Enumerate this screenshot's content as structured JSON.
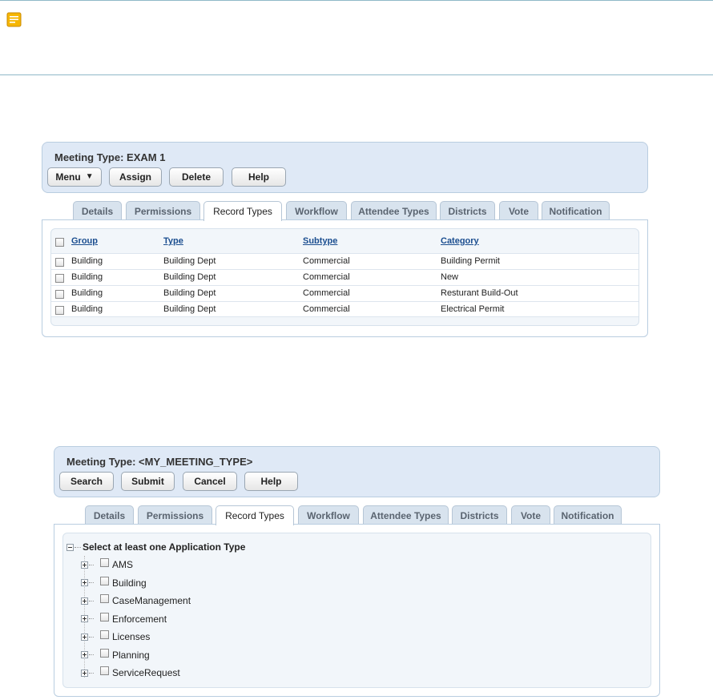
{
  "panel1": {
    "title": "Meeting Type: EXAM 1",
    "buttons": {
      "menu": "Menu",
      "assign": "Assign",
      "delete": "Delete",
      "help": "Help"
    },
    "tabs": [
      "Details",
      "Permissions",
      "Record Types",
      "Workflow",
      "Attendee Types",
      "Districts",
      "Vote",
      "Notification"
    ],
    "active_tab": "Record Types",
    "table": {
      "headers": {
        "group": "Group",
        "type": "Type",
        "subtype": "Subtype",
        "category": "Category"
      },
      "rows": [
        {
          "group": "Building",
          "type": "Building Dept",
          "subtype": "Commercial",
          "category": "Building Permit"
        },
        {
          "group": "Building",
          "type": "Building Dept",
          "subtype": "Commercial",
          "category": "New"
        },
        {
          "group": "Building",
          "type": "Building Dept",
          "subtype": "Commercial",
          "category": "Resturant Build-Out"
        },
        {
          "group": "Building",
          "type": "Building Dept",
          "subtype": "Commercial",
          "category": "Electrical Permit"
        }
      ]
    }
  },
  "panel2": {
    "title": "Meeting Type: <MY_MEETING_TYPE>",
    "buttons": {
      "search": "Search",
      "submit": "Submit",
      "cancel": "Cancel",
      "help": "Help"
    },
    "tabs": [
      "Details",
      "Permissions",
      "Record Types",
      "Workflow",
      "Attendee Types",
      "Districts",
      "Vote",
      "Notification"
    ],
    "active_tab": "Record Types",
    "tree": {
      "root_label": "Select at least one Application Type",
      "items": [
        "AMS",
        "Building",
        "CaseManagement",
        "Enforcement",
        "Licenses",
        "Planning",
        "ServiceRequest"
      ]
    }
  },
  "colors": {
    "accent": "#1a4d8f",
    "panel_bg": "#dfe9f6",
    "note_icon": "#f0a500"
  },
  "icons": {
    "note": "note-icon",
    "menu_arrow": "menu-arrow-icon"
  }
}
